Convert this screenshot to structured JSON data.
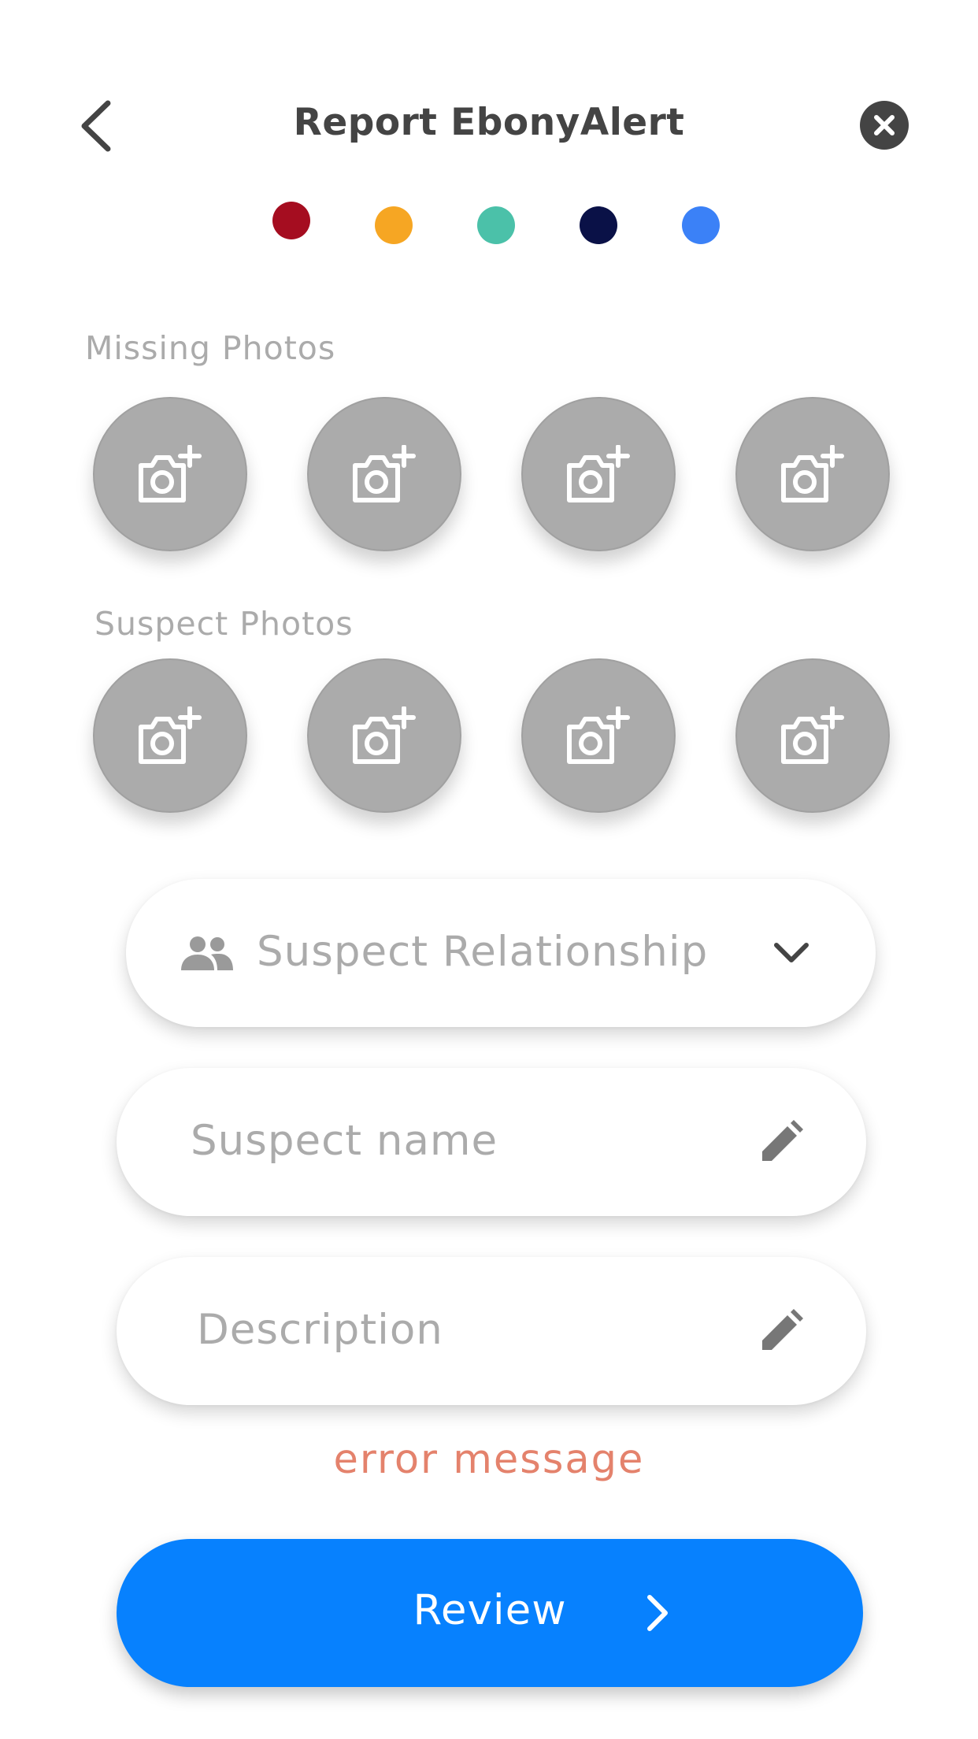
{
  "header": {
    "title": "Report EbonyAlert",
    "back_icon": "chevron-left-icon",
    "close_icon": "close-circle-icon"
  },
  "steps": {
    "colors": [
      "#a50d20",
      "#f6a623",
      "#4bc1a9",
      "#0a1147",
      "#3b81f7"
    ]
  },
  "missing_photos": {
    "label": "Missing Photos",
    "slots": 4,
    "icon": "add-photo-icon"
  },
  "suspect_photos": {
    "label": "Suspect Photos",
    "slots": 4,
    "icon": "add-photo-icon"
  },
  "form": {
    "relationship": {
      "placeholder": "Suspect Relationship",
      "icon": "people-icon",
      "dropdown_icon": "chevron-down-icon"
    },
    "suspect_name": {
      "placeholder": "Suspect name",
      "icon": "pencil-icon"
    },
    "description": {
      "placeholder": "Description",
      "icon": "pencil-icon"
    },
    "error_message": "error message"
  },
  "review_button": {
    "label": "Review",
    "icon": "chevron-right-icon"
  },
  "colors": {
    "accent": "#0781fe",
    "error": "#e4826c",
    "placeholder": "#ababab",
    "photo_circle": "#ababab"
  }
}
